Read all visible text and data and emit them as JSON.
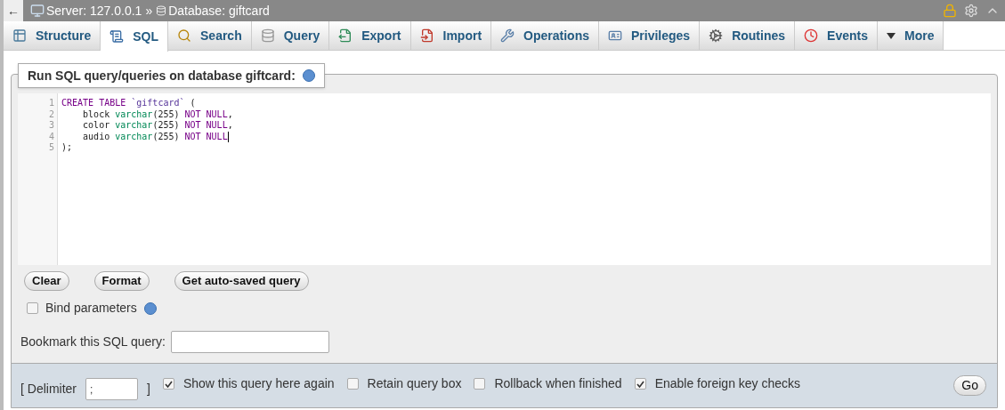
{
  "breadcrumb": {
    "back": "←",
    "server": "Server: 127.0.0.1",
    "separator": "»",
    "database": "Database: giftcard"
  },
  "tabs": [
    {
      "label": "Structure",
      "selected": false
    },
    {
      "label": "SQL",
      "selected": true
    },
    {
      "label": "Search",
      "selected": false
    },
    {
      "label": "Query",
      "selected": false
    },
    {
      "label": "Export",
      "selected": false
    },
    {
      "label": "Import",
      "selected": false
    },
    {
      "label": "Operations",
      "selected": false
    },
    {
      "label": "Privileges",
      "selected": false
    },
    {
      "label": "Routines",
      "selected": false
    },
    {
      "label": "Events",
      "selected": false
    },
    {
      "label": "More",
      "selected": false
    }
  ],
  "legend": "Run SQL query/queries on database giftcard:",
  "editor": {
    "lines": [
      {
        "number": "1",
        "tokens": [
          {
            "kind": "keyword",
            "text": "CREATE TABLE "
          },
          {
            "kind": "identifier",
            "text": "`giftcard`"
          },
          {
            "kind": "plain",
            "text": " ("
          }
        ]
      },
      {
        "number": "2",
        "tokens": [
          {
            "kind": "plain",
            "text": "    block "
          },
          {
            "kind": "type",
            "text": "varchar"
          },
          {
            "kind": "plain",
            "text": "(255) "
          },
          {
            "kind": "keyword",
            "text": "NOT NULL"
          },
          {
            "kind": "plain",
            "text": ","
          }
        ]
      },
      {
        "number": "3",
        "tokens": [
          {
            "kind": "plain",
            "text": "    color "
          },
          {
            "kind": "type",
            "text": "varchar"
          },
          {
            "kind": "plain",
            "text": "(255) "
          },
          {
            "kind": "keyword",
            "text": "NOT NULL"
          },
          {
            "kind": "plain",
            "text": ","
          }
        ]
      },
      {
        "number": "4",
        "tokens": [
          {
            "kind": "plain",
            "text": "    audio "
          },
          {
            "kind": "type",
            "text": "varchar"
          },
          {
            "kind": "plain",
            "text": "(255) "
          },
          {
            "kind": "keyword",
            "text": "NOT NULL"
          }
        ]
      },
      {
        "number": "5",
        "tokens": [
          {
            "kind": "plain",
            "text": ");"
          }
        ]
      }
    ]
  },
  "buttons": [
    "Clear",
    "Format",
    "Get auto-saved query"
  ],
  "bind_parameters": {
    "label": "Bind parameters",
    "checked": false
  },
  "bookmark": {
    "label": "Bookmark this SQL query:"
  },
  "footer": {
    "delimiter_open": "[ Delimiter",
    "delimiter_value": ";",
    "delimiter_close": "]",
    "options": [
      {
        "label": "Show this query here again",
        "checked": true
      },
      {
        "label": "Retain query box",
        "checked": false
      },
      {
        "label": "Rollback when finished",
        "checked": false
      },
      {
        "label": "Enable foreign key checks",
        "checked": true
      }
    ],
    "go": "Go"
  }
}
